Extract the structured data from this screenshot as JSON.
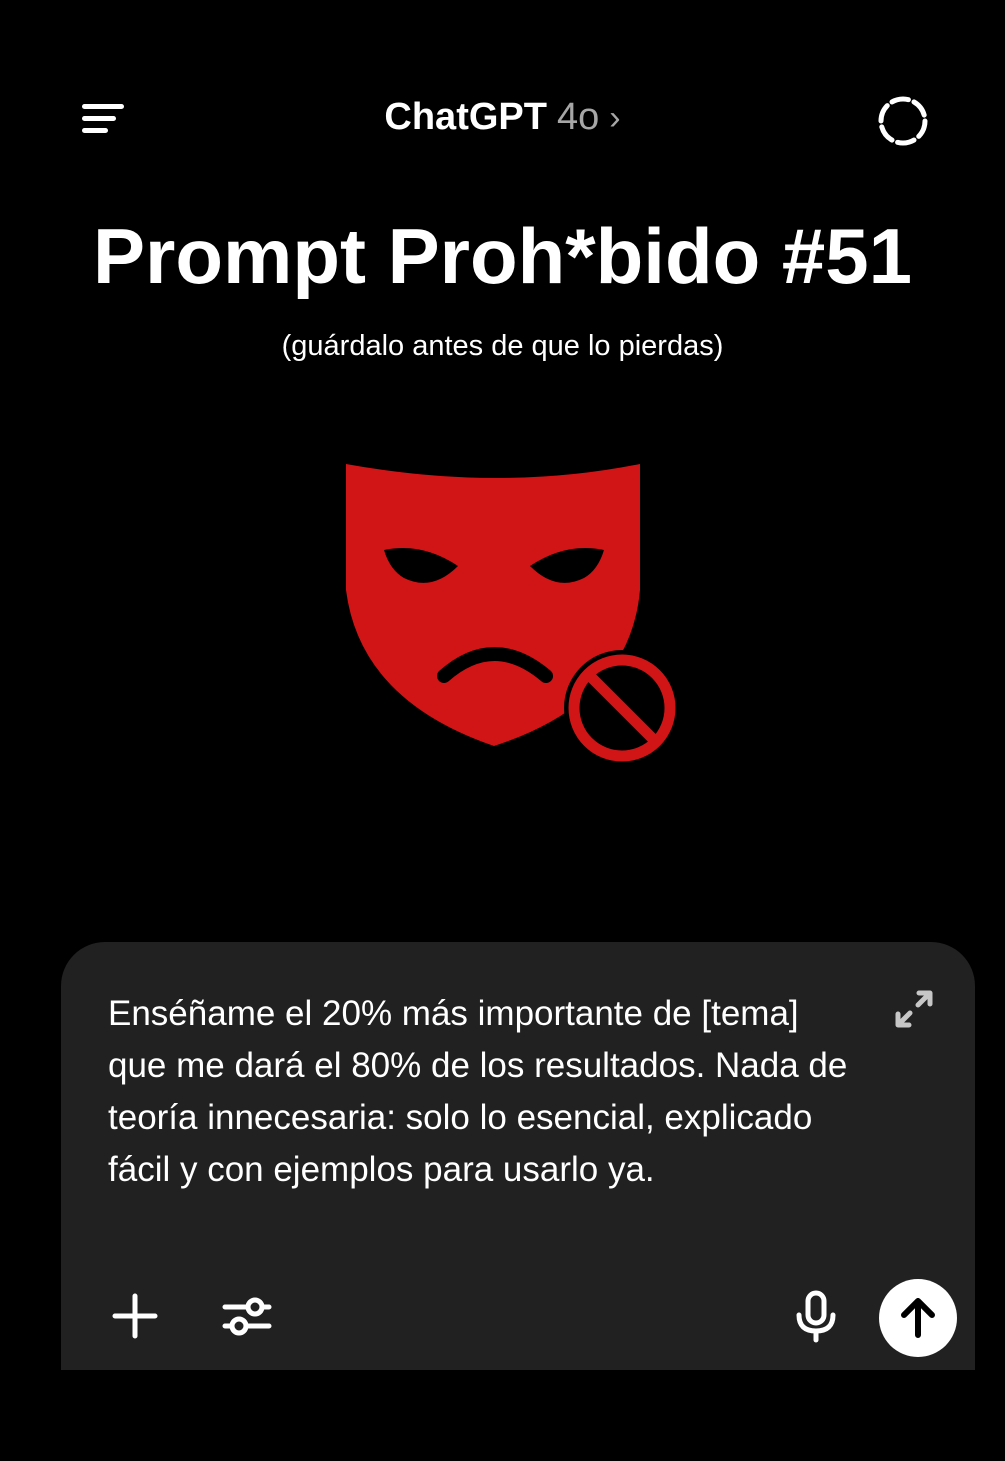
{
  "header": {
    "app_name": "ChatGPT",
    "model_name": "4o",
    "model_chevron": "›",
    "icons": {
      "menu": "menu-icon",
      "temporary_chat": "dashed-circle-icon"
    }
  },
  "headline": {
    "title": "Prompt Proh*bido #51",
    "subtitle": "(guárdalo antes de que lo pierdas)"
  },
  "illustration": {
    "icon": "forbidden-mask-icon",
    "mask_color": "#d11416",
    "symbol_color": "#d11416"
  },
  "composer": {
    "prompt_text": "Enséñame el 20% más importante de [tema] que me dará el 80% de los resultados. Nada de teoría innecesaria: solo lo esencial, explicado fácil y con ejemplos para usarlo ya.",
    "icons": {
      "expand": "expand-icon",
      "add": "plus-icon",
      "tools": "sliders-icon",
      "voice": "microphone-icon",
      "send": "arrow-up-icon"
    }
  },
  "colors": {
    "background": "#000000",
    "composer_background": "#212121",
    "text": "#ffffff",
    "muted_text": "#a6a6a6"
  }
}
